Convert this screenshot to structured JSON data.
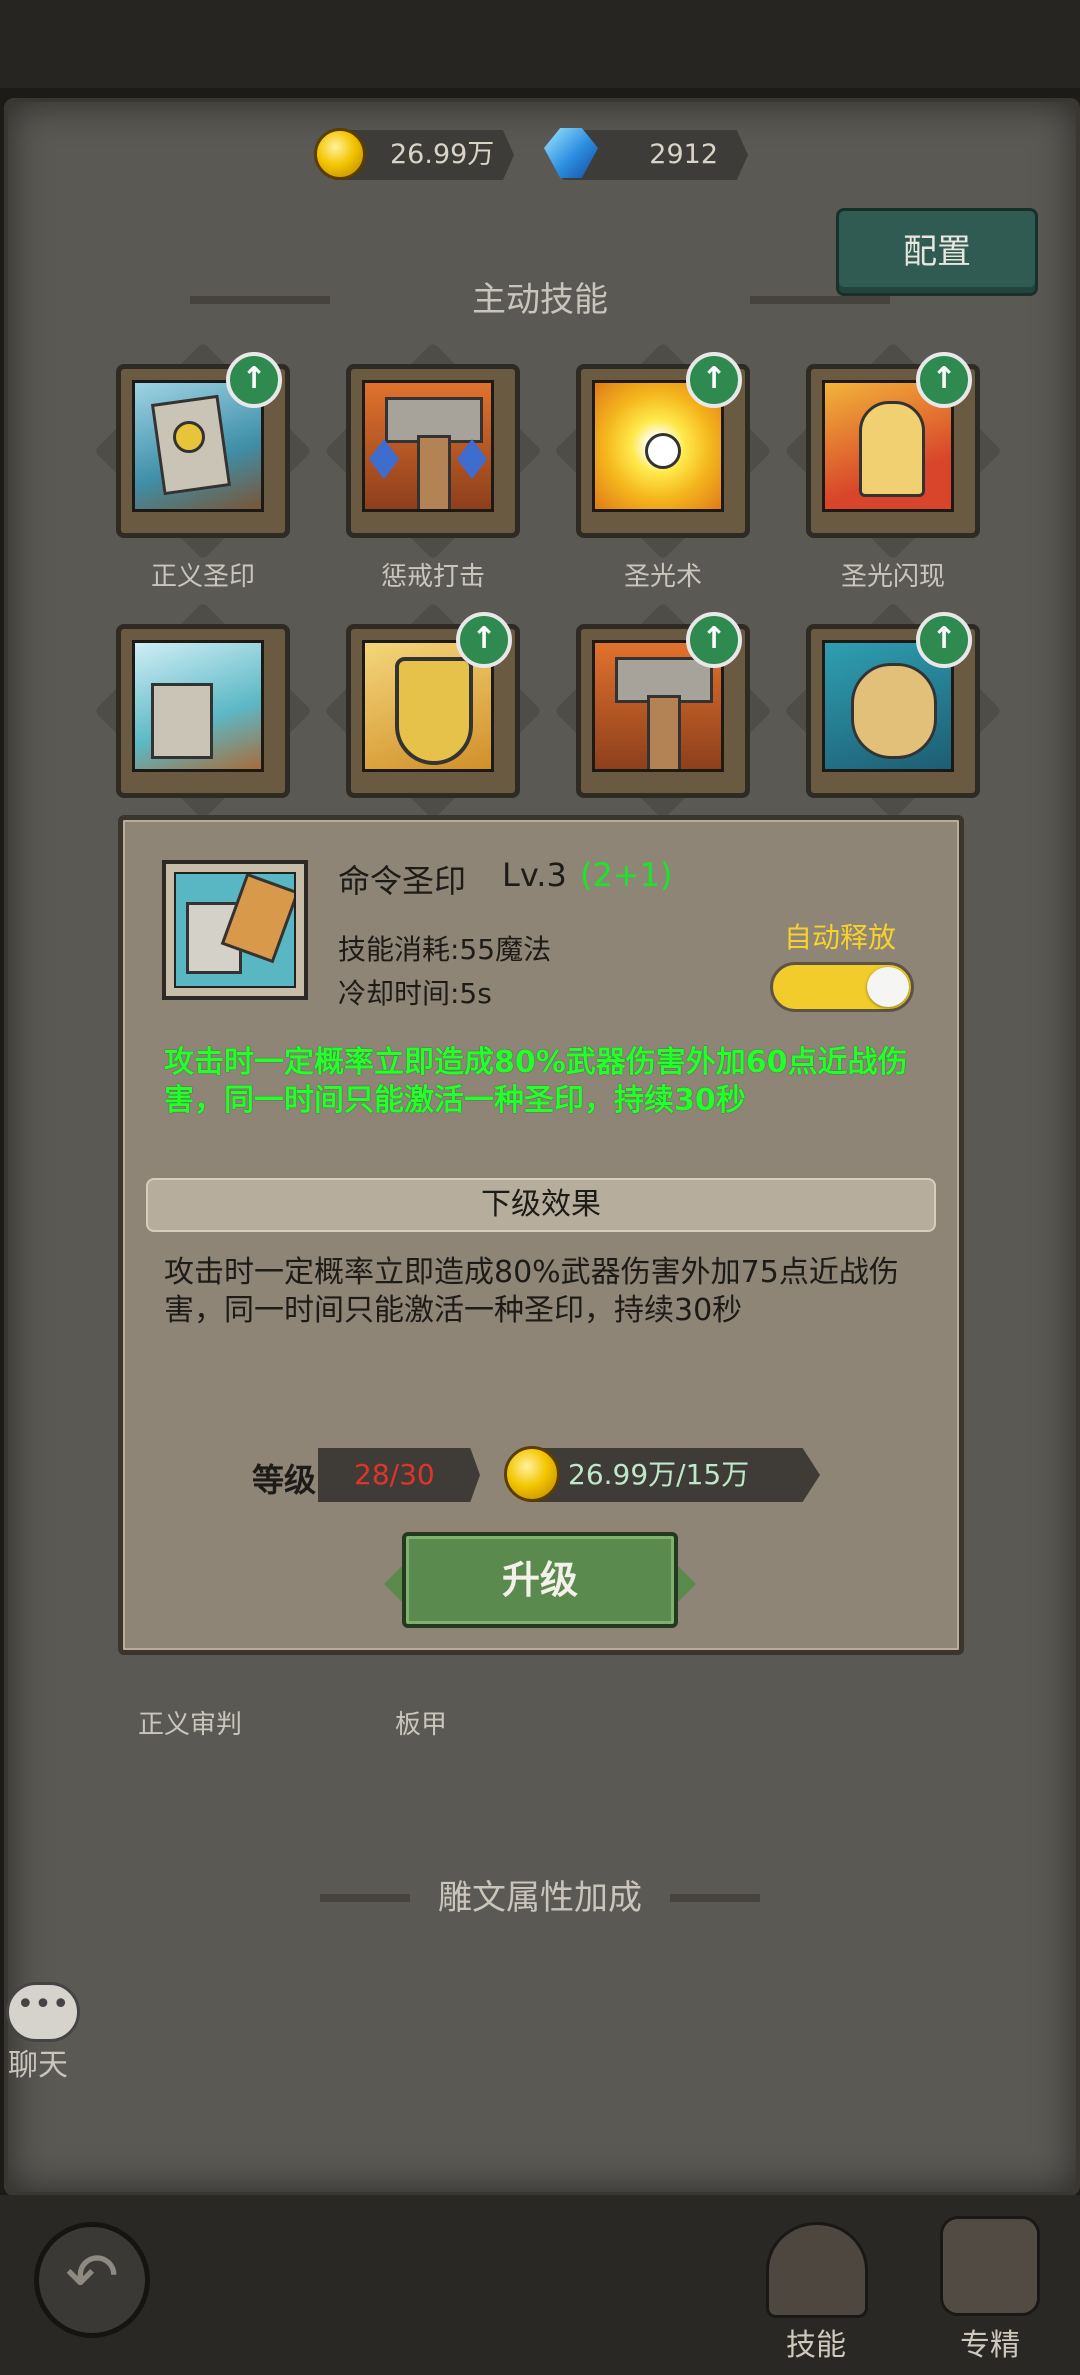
{
  "resources": {
    "gold": "26.99万",
    "gems": "2912"
  },
  "config_button": "配置",
  "sections": {
    "active": "主动技能",
    "glyph": "雕文属性加成"
  },
  "skills_row1": [
    {
      "name": "正义圣印",
      "upgradable": true
    },
    {
      "name": "惩戒打击",
      "upgradable": false
    },
    {
      "name": "圣光术",
      "upgradable": true
    },
    {
      "name": "圣光闪现",
      "upgradable": true
    }
  ],
  "skills_row2": [
    {
      "name": "",
      "upgradable": false
    },
    {
      "name": "",
      "upgradable": true
    },
    {
      "name": "",
      "upgradable": true
    },
    {
      "name": "",
      "upgradable": true
    }
  ],
  "behind_labels": [
    "正义审判",
    "板甲"
  ],
  "popup": {
    "title": "命令圣印",
    "level": "Lv.3",
    "level_bonus": "(2+1)",
    "cost_label": "技能消耗:55魔法",
    "cooldown_label": "冷却时间:5s",
    "auto_cast": "自动释放",
    "auto_cast_on": true,
    "current_effect": "攻击时一定概率立即造成80%武器伤害外加60点近战伤害，同一时间只能激活一种圣印，持续30秒",
    "next_header": "下级效果",
    "next_effect": "攻击时一定概率立即造成80%武器伤害外加75点近战伤害，同一时间只能激活一种圣印，持续30秒",
    "level_label": "等级",
    "level_value": "28/30",
    "upgrade_cost": "26.99万/15万",
    "upgrade_button": "升级"
  },
  "chat_label": "聊天",
  "tabs": [
    {
      "label": "技能"
    },
    {
      "label": "专精"
    }
  ],
  "colors": {
    "accent_green": "#23ff2a",
    "level_red": "#e0342b",
    "toggle_yellow": "#f2cc2a"
  }
}
